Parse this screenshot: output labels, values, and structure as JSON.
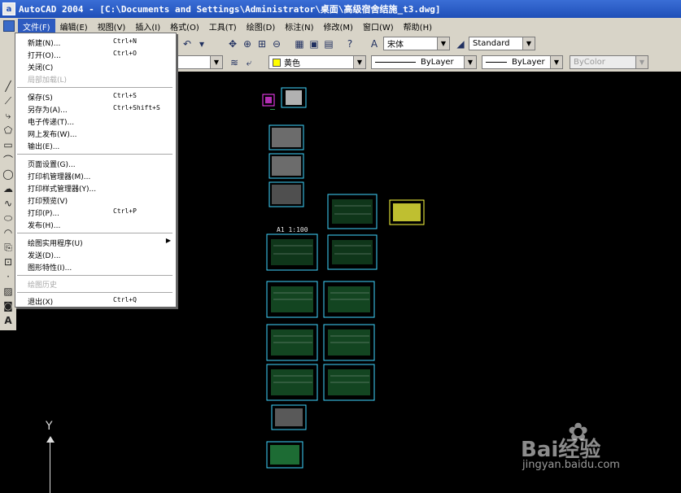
{
  "window": {
    "title": "AutoCAD 2004 - [C:\\Documents and Settings\\Administrator\\桌面\\高级宿舍结施_t3.dwg]",
    "app_icon": "a"
  },
  "menubar": {
    "items": [
      "文件(F)",
      "编辑(E)",
      "视图(V)",
      "插入(I)",
      "格式(O)",
      "工具(T)",
      "绘图(D)",
      "标注(N)",
      "修改(M)",
      "窗口(W)",
      "帮助(H)"
    ],
    "active_index": 0
  },
  "toolbar": {
    "font_combo": "宋体",
    "style_combo": "Standard",
    "layer_color": "黄色",
    "linetype": "ByLayer",
    "lineweight": "ByLayer",
    "plotstyle": "ByColor",
    "accent_color": "#ffff00"
  },
  "file_menu": {
    "items": [
      {
        "label": "新建(N)...",
        "shortcut": "Ctrl+N",
        "disabled": false
      },
      {
        "label": "打开(O)...",
        "shortcut": "Ctrl+O",
        "disabled": false
      },
      {
        "label": "关闭(C)",
        "shortcut": "",
        "disabled": false
      },
      {
        "label": "局部加载(L)",
        "shortcut": "",
        "disabled": true
      },
      {
        "label": "保存(S)",
        "shortcut": "Ctrl+S",
        "disabled": false
      },
      {
        "label": "另存为(A)...",
        "shortcut": "Ctrl+Shift+S",
        "disabled": false
      },
      {
        "label": "电子传递(T)...",
        "shortcut": "",
        "disabled": false
      },
      {
        "label": "网上发布(W)...",
        "shortcut": "",
        "disabled": false
      },
      {
        "label": "输出(E)...",
        "shortcut": "",
        "disabled": false
      },
      {
        "label": "页面设置(G)...",
        "shortcut": "",
        "disabled": false
      },
      {
        "label": "打印机管理器(M)...",
        "shortcut": "",
        "disabled": false
      },
      {
        "label": "打印样式管理器(Y)...",
        "shortcut": "",
        "disabled": false
      },
      {
        "label": "打印预览(V)",
        "shortcut": "",
        "disabled": false
      },
      {
        "label": "打印(P)...",
        "shortcut": "Ctrl+P",
        "disabled": false
      },
      {
        "label": "发布(H)...",
        "shortcut": "",
        "disabled": false
      },
      {
        "label": "绘图实用程序(U)",
        "shortcut": "",
        "disabled": false,
        "submenu": true
      },
      {
        "label": "发送(D)...",
        "shortcut": "",
        "disabled": false
      },
      {
        "label": "图形特性(I)...",
        "shortcut": "",
        "disabled": false
      },
      {
        "label": "绘图历史",
        "shortcut": "",
        "disabled": true
      },
      {
        "label": "退出(X)",
        "shortcut": "Ctrl+Q",
        "disabled": false
      }
    ]
  },
  "canvas": {
    "sheet_label": "A1 1:100",
    "ucs_label": "Y"
  },
  "watermark": {
    "text": "Bai经验",
    "url": "jingyan.baidu.com"
  }
}
